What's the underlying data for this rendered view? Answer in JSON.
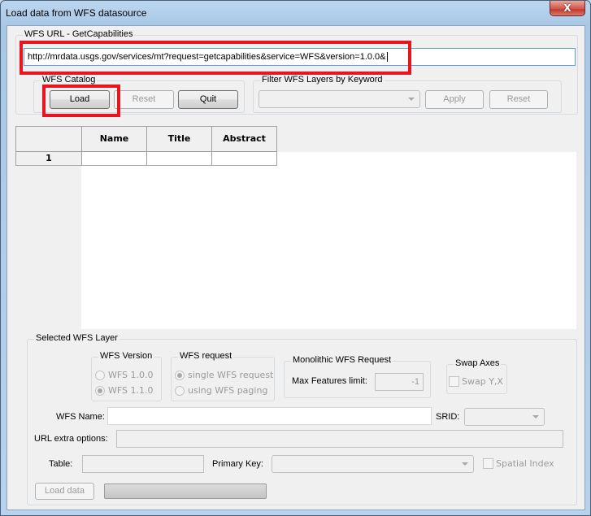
{
  "window": {
    "title": "Load data from WFS datasource",
    "close_label": "X"
  },
  "url_group": {
    "label": "WFS URL - GetCapabilities",
    "url_value": "http://mrdata.usgs.gov/services/mt?request=getcapabilities&service=WFS&version=1.0.0&"
  },
  "catalog_group": {
    "label": "WFS Catalog",
    "load_label": "Load",
    "reset_label": "Reset",
    "quit_label": "Quit"
  },
  "filter_group": {
    "label": "Filter WFS Layers by Keyword",
    "keyword_value": "",
    "apply_label": "Apply",
    "reset_label": "Reset"
  },
  "layers_table": {
    "columns": [
      "Name",
      "Title",
      "Abstract"
    ],
    "rows": [
      {
        "index": "1",
        "name": "",
        "title": "",
        "abstract": ""
      }
    ]
  },
  "selected_layer": {
    "label": "Selected WFS Layer",
    "version_group": {
      "label": "WFS Version",
      "options": [
        "WFS 1.0.0",
        "WFS 1.1.0"
      ],
      "selected": "WFS 1.1.0"
    },
    "request_group": {
      "label": "WFS request",
      "options": [
        "single WFS request",
        "using WFS paging"
      ],
      "selected": "single WFS request"
    },
    "monolithic_group": {
      "label": "Monolithic WFS Request",
      "max_features_label": "Max Features limit:",
      "max_features_value": "-1"
    },
    "swap_group": {
      "label": "Swap Axes",
      "swap_label": "Swap Y,X",
      "swap_checked": false
    },
    "wfs_name_label": "WFS Name:",
    "wfs_name_value": "",
    "srid_label": "SRID:",
    "srid_value": "",
    "url_extra_label": "URL extra options:",
    "url_extra_value": "",
    "table_label": "Table:",
    "table_value": "",
    "primary_key_label": "Primary Key:",
    "primary_key_value": "",
    "spatial_index_label": "Spatial Index",
    "spatial_index_checked": false,
    "load_data_label": "Load data",
    "progress_percent": 0
  },
  "annotations": {
    "highlight_color": "#e8141e"
  }
}
